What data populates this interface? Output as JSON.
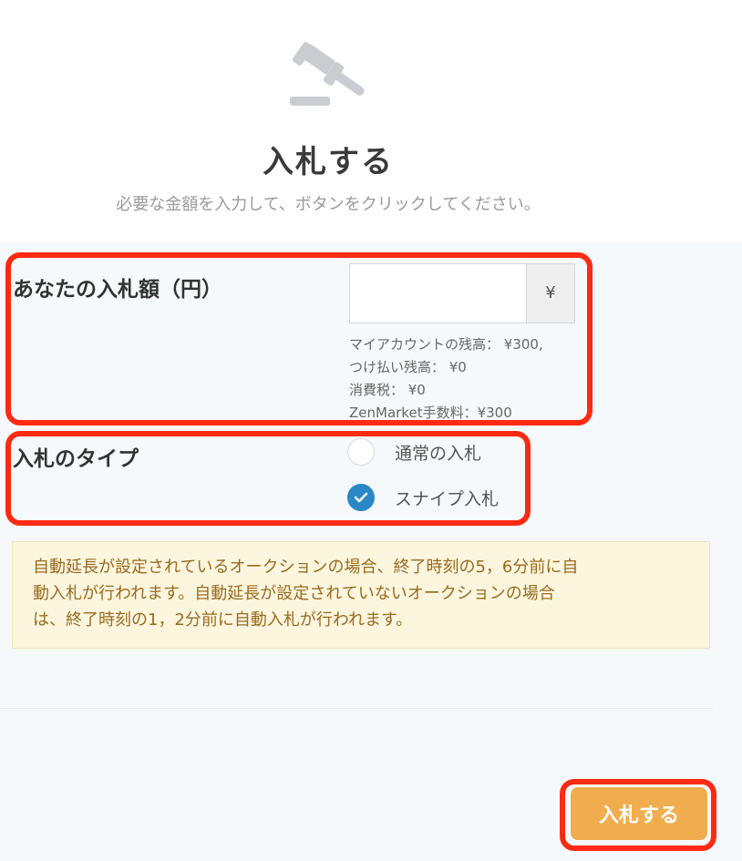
{
  "header": {
    "icon": "gavel-icon",
    "title": "入札する",
    "subtitle": "必要な金額を入力して、ボタンをクリックしてください。"
  },
  "amount": {
    "label": "あなたの入札額（円）",
    "input_value": "",
    "currency_addon": "¥",
    "info": {
      "balance": "マイアカウントの残高： ¥300,",
      "deferred": "つけ払い残高： ¥0",
      "tax": "消費税： ¥0",
      "fee": "ZenMarket手数料：¥300"
    }
  },
  "bid_type": {
    "label": "入札のタイプ",
    "options": [
      {
        "label": "通常の入札",
        "checked": false
      },
      {
        "label": "スナイプ入札",
        "checked": true
      }
    ]
  },
  "notice": {
    "line1": "自動延長が設定されているオークションの場合、終了時刻の5，6分前に自",
    "line2": "動入札が行われます。自動延長が設定されていないオークションの場合",
    "line3": "は、終了時刻の1，2分前に自動入札が行われます。"
  },
  "submit": {
    "label": "入札する"
  },
  "colors": {
    "accent_button": "#f0ad4e",
    "radio_checked": "#2a88c6",
    "highlight_outline": "#ff2a12",
    "notice_bg": "#fdf6df",
    "notice_text": "#9a6a1e"
  }
}
